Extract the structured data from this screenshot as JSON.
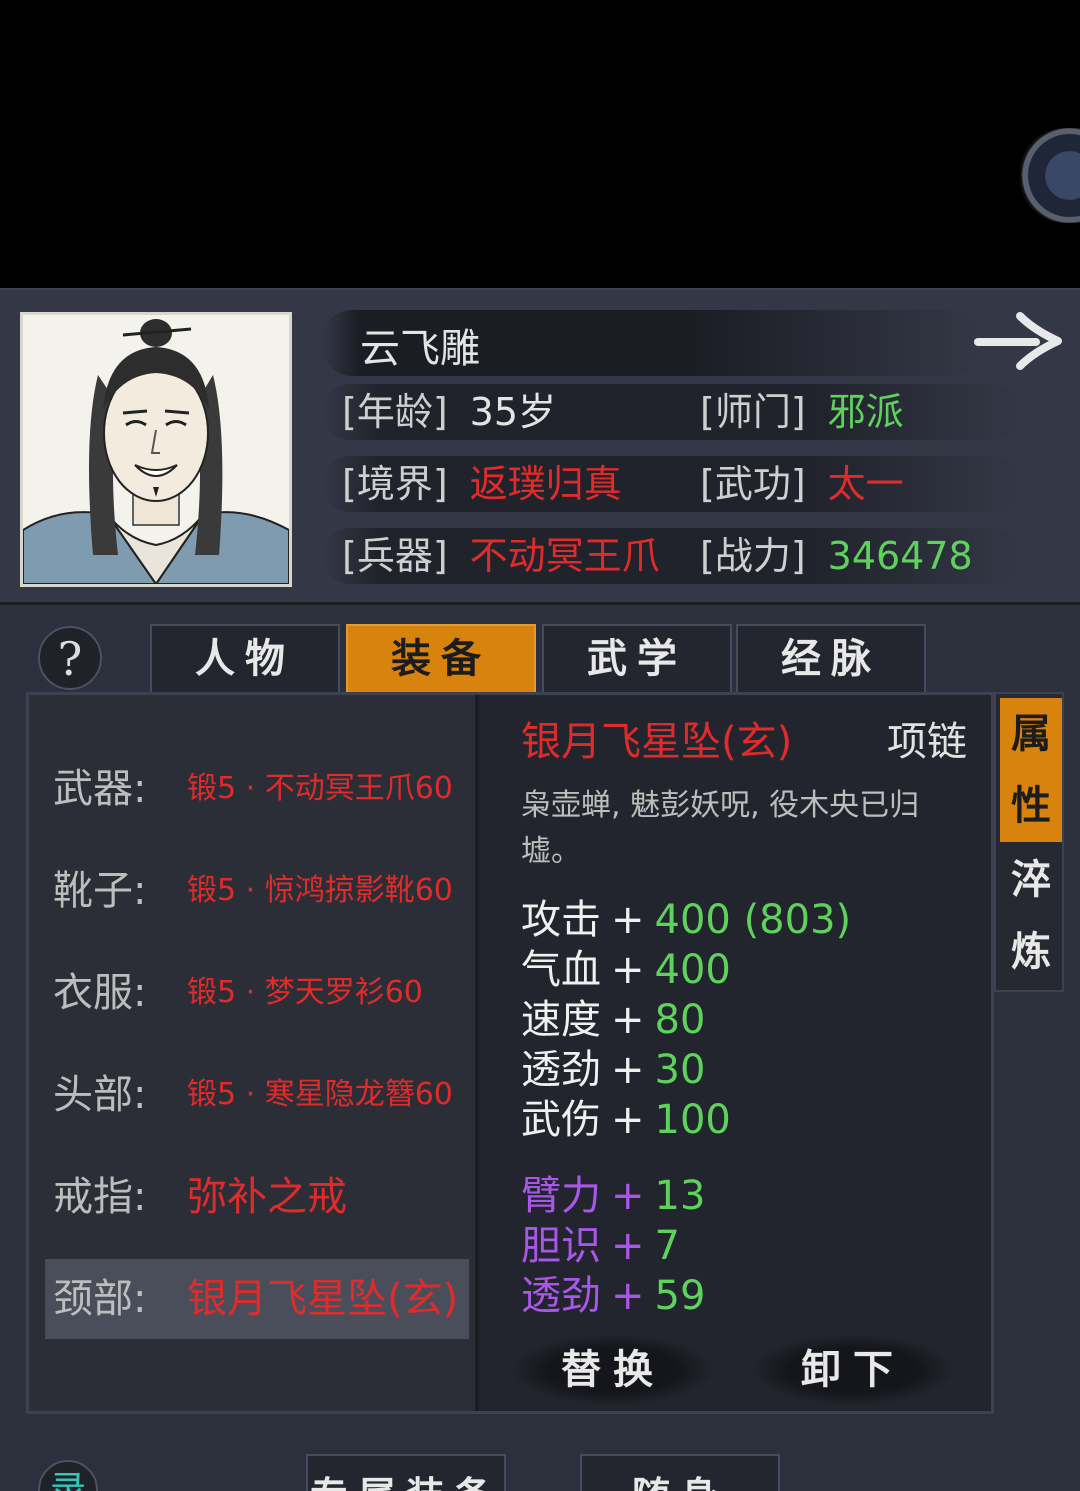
{
  "character": {
    "name": "云飞雕",
    "rows": [
      [
        {
          "label": "[年龄]",
          "value": "35岁",
          "color": "#e4e4e4"
        },
        {
          "label": "[师门]",
          "value": "邪派",
          "color": "#5ed25c"
        }
      ],
      [
        {
          "label": "[境界]",
          "value": "返璞归真",
          "color": "#e02b2b"
        },
        {
          "label": "[武功]",
          "value": "太一",
          "color": "#e02b2b"
        }
      ],
      [
        {
          "label": "[兵器]",
          "value": "不动冥王爪",
          "color": "#e02b2b"
        },
        {
          "label": "[战力]",
          "value": "346478",
          "color": "#5ed25c"
        }
      ]
    ]
  },
  "tabs": [
    "人物",
    "装备",
    "武学",
    "经脉"
  ],
  "active_tab": "装备",
  "help_symbol": "?",
  "slots": [
    {
      "label": "武器:",
      "value": "锻5 · 不动冥王爪60"
    },
    {
      "label": "靴子:",
      "value": "锻5 · 惊鸿掠影靴60"
    },
    {
      "label": "衣服:",
      "value": "锻5 · 梦天罗衫60"
    },
    {
      "label": "头部:",
      "value": "锻5 · 寒星隐龙簪60"
    },
    {
      "label": "戒指:",
      "value": "弥补之戒"
    },
    {
      "label": "颈部:",
      "value": "银月飞星坠(玄)"
    }
  ],
  "detail": {
    "name": "银月飞星坠(玄)",
    "type": "项链",
    "description": "枭壶蝉, 魅彭妖呪, 役木央已归墟。",
    "stats": [
      {
        "name": "攻击",
        "value": "400 (803)"
      },
      {
        "name": "气血",
        "value": "400"
      },
      {
        "name": "速度",
        "value": "80"
      },
      {
        "name": "透劲",
        "value": "30"
      },
      {
        "name": "武伤",
        "value": "100"
      }
    ],
    "bonus_stats": [
      {
        "name": "臂力",
        "value": "13"
      },
      {
        "name": "胆识",
        "value": "7"
      },
      {
        "name": "透劲",
        "value": "59"
      }
    ],
    "plus_sign": "+",
    "buttons": {
      "replace": "替换",
      "unequip": "卸下"
    }
  },
  "side_tabs": [
    {
      "label": "属性",
      "active": true
    },
    {
      "label": "淬炼",
      "active": false
    }
  ],
  "bottom": {
    "icon_glyph": "录",
    "tabs": [
      "专属装备",
      "随身"
    ]
  }
}
